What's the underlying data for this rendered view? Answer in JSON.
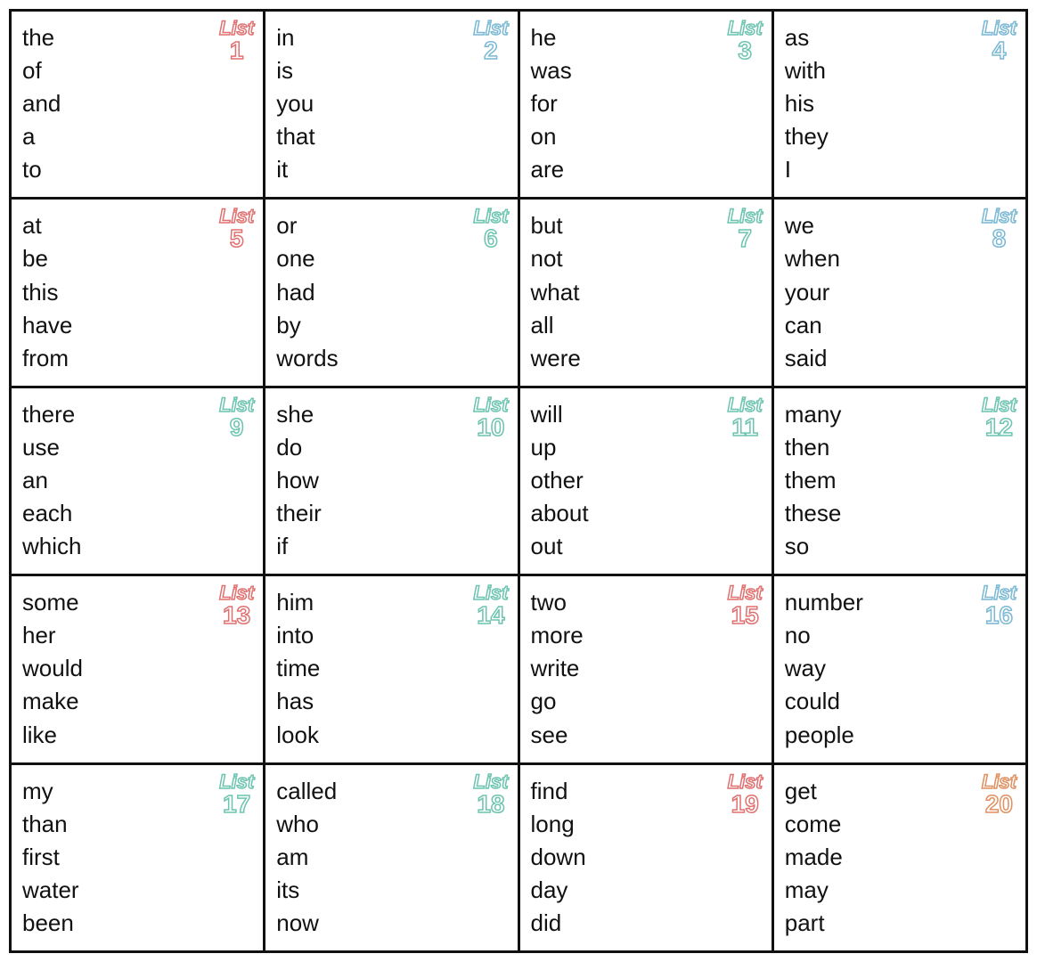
{
  "cells": [
    {
      "id": 1,
      "list_num": "1",
      "list_color": "red",
      "words": [
        "the",
        "of",
        "and",
        "a",
        "to"
      ]
    },
    {
      "id": 2,
      "list_num": "2",
      "list_color": "blue",
      "words": [
        "in",
        "is",
        "you",
        "that",
        "it"
      ]
    },
    {
      "id": 3,
      "list_num": "3",
      "list_color": "teal",
      "words": [
        "he",
        "was",
        "for",
        "on",
        "are"
      ]
    },
    {
      "id": 4,
      "list_num": "4",
      "list_color": "blue",
      "words": [
        "as",
        "with",
        "his",
        "they",
        "I"
      ]
    },
    {
      "id": 5,
      "list_num": "5",
      "list_color": "red",
      "words": [
        "at",
        "be",
        "this",
        "have",
        "from"
      ]
    },
    {
      "id": 6,
      "list_num": "6",
      "list_color": "teal",
      "words": [
        "or",
        "one",
        "had",
        "by",
        "words"
      ]
    },
    {
      "id": 7,
      "list_num": "7",
      "list_color": "teal",
      "words": [
        "but",
        "not",
        "what",
        "all",
        "were"
      ]
    },
    {
      "id": 8,
      "list_num": "8",
      "list_color": "blue",
      "words": [
        "we",
        "when",
        "your",
        "can",
        "said"
      ]
    },
    {
      "id": 9,
      "list_num": "9",
      "list_color": "teal",
      "words": [
        "there",
        "use",
        "an",
        "each",
        "which"
      ]
    },
    {
      "id": 10,
      "list_num": "10",
      "list_color": "teal",
      "words": [
        "she",
        "do",
        "how",
        "their",
        "if"
      ]
    },
    {
      "id": 11,
      "list_num": "11",
      "list_color": "teal",
      "words": [
        "will",
        "up",
        "other",
        "about",
        "out"
      ]
    },
    {
      "id": 12,
      "list_num": "12",
      "list_color": "teal",
      "words": [
        "many",
        "then",
        "them",
        "these",
        "so"
      ]
    },
    {
      "id": 13,
      "list_num": "13",
      "list_color": "red",
      "words": [
        "some",
        "her",
        "would",
        "make",
        "like"
      ]
    },
    {
      "id": 14,
      "list_num": "14",
      "list_color": "teal",
      "words": [
        "him",
        "into",
        "time",
        "has",
        "look"
      ]
    },
    {
      "id": 15,
      "list_num": "15",
      "list_color": "red",
      "words": [
        "two",
        "more",
        "write",
        "go",
        "see"
      ]
    },
    {
      "id": 16,
      "list_num": "16",
      "list_color": "blue",
      "words": [
        "number",
        "no",
        "way",
        "could",
        "people"
      ]
    },
    {
      "id": 17,
      "list_num": "17",
      "list_color": "teal",
      "words": [
        "my",
        "than",
        "first",
        "water",
        "been"
      ]
    },
    {
      "id": 18,
      "list_num": "18",
      "list_color": "teal",
      "words": [
        "called",
        "who",
        "am",
        "its",
        "now"
      ]
    },
    {
      "id": 19,
      "list_num": "19",
      "list_color": "red",
      "words": [
        "find",
        "long",
        "down",
        "day",
        "did"
      ]
    },
    {
      "id": 20,
      "list_num": "20",
      "list_color": "orange",
      "words": [
        "get",
        "come",
        "made",
        "may",
        "part"
      ]
    }
  ],
  "list_label": "List"
}
